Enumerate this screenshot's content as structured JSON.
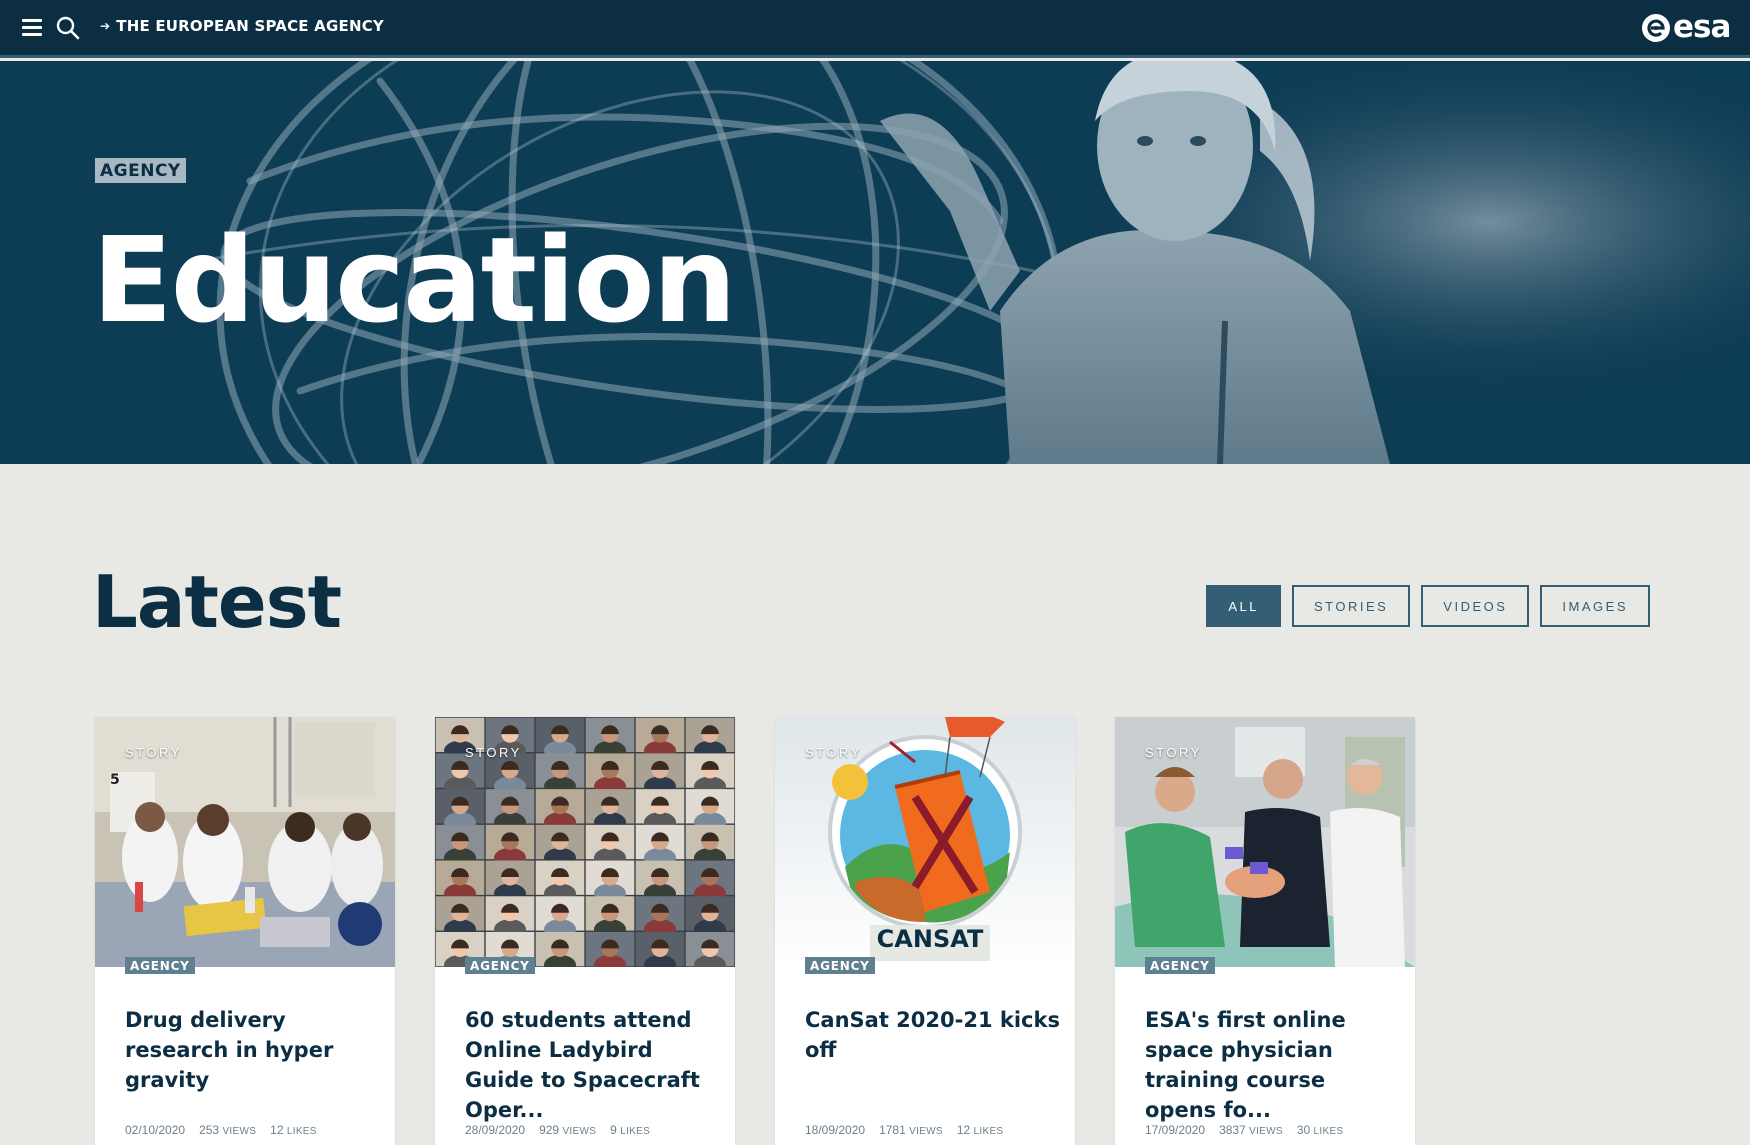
{
  "header": {
    "brand_link": "THE EUROPEAN SPACE AGENCY",
    "logo_text": "esa",
    "icons": [
      "menu-icon",
      "search-icon",
      "arrow-icon",
      "esa-logo"
    ]
  },
  "hero": {
    "tag": "AGENCY",
    "title": "Education"
  },
  "latest": {
    "title": "Latest",
    "filters": [
      "ALL",
      "STORIES",
      "VIDEOS",
      "IMAGES"
    ],
    "active_filter": "ALL"
  },
  "cards": [
    {
      "type": "STORY",
      "tag": "AGENCY",
      "title": "Drug delivery research in hyper gravity",
      "date": "02/10/2020",
      "views": "253",
      "views_unit": "VIEWS",
      "likes": "12",
      "likes_unit": "LIKES",
      "image_badge": "5"
    },
    {
      "type": "STORY",
      "tag": "AGENCY",
      "title": "60 students attend Online Ladybird Guide to Spacecraft Oper...",
      "date": "28/09/2020",
      "views": "929",
      "views_unit": "VIEWS",
      "likes": "9",
      "likes_unit": "LIKES"
    },
    {
      "type": "STORY",
      "tag": "AGENCY",
      "title": "CanSat 2020-21 kicks off",
      "date": "18/09/2020",
      "views": "1781",
      "views_unit": "VIEWS",
      "likes": "12",
      "likes_unit": "LIKES",
      "image_label": "CANSAT"
    },
    {
      "type": "STORY",
      "tag": "AGENCY",
      "title": "ESA's first online space physician training course opens fo...",
      "date": "17/09/2020",
      "views": "3837",
      "views_unit": "VIEWS",
      "likes": "30",
      "likes_unit": "LIKES"
    }
  ],
  "colors": {
    "navy": "#0b2e43",
    "hero": "#0d3c55",
    "accent": "#335e74",
    "tag": "#5f8090",
    "background": "#e8e8e4"
  }
}
